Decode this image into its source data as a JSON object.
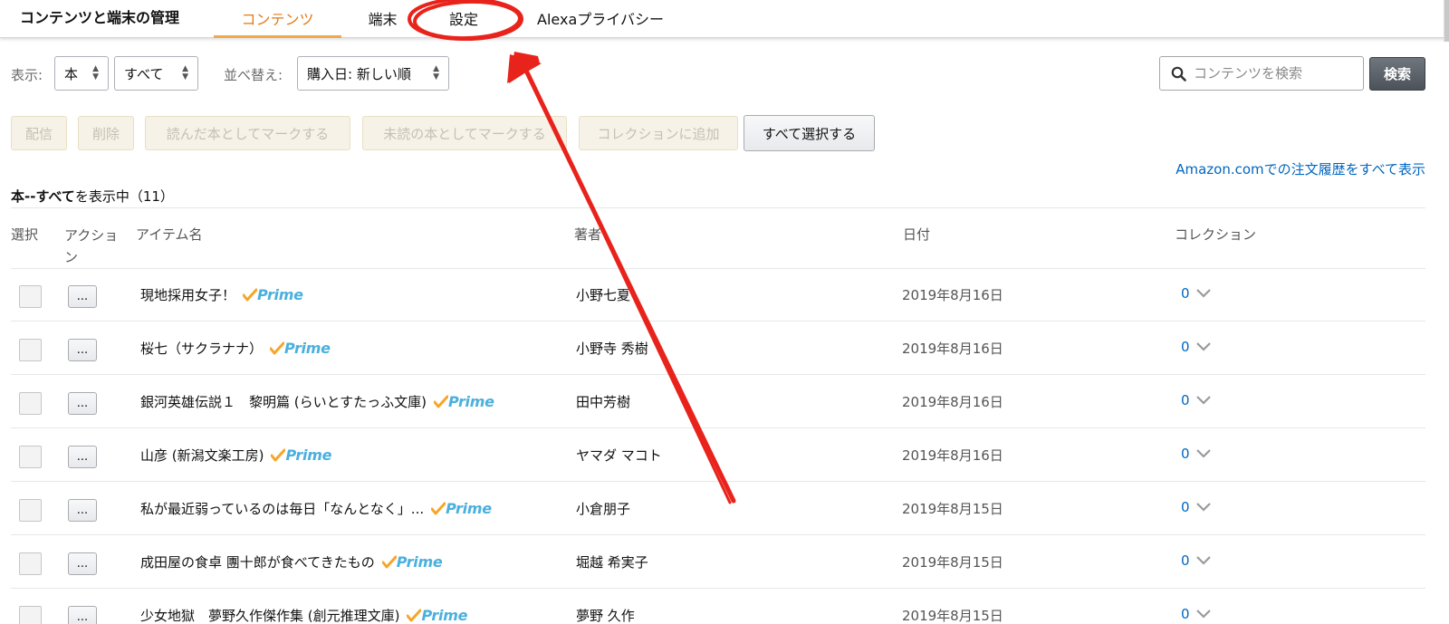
{
  "header": {
    "app_title": "コンテンツと端末の管理",
    "tabs": [
      {
        "label": "コンテンツ",
        "active": true
      },
      {
        "label": "端末",
        "active": false
      },
      {
        "label": "設定",
        "active": false
      },
      {
        "label": "Alexaプライバシー",
        "active": false
      }
    ]
  },
  "filters": {
    "display_label": "表示:",
    "display_type": "本",
    "display_scope": "すべて",
    "sort_label": "並べ替え:",
    "sort_value": "購入日: 新しい順",
    "search_placeholder": "コンテンツを検索",
    "search_button": "検索"
  },
  "actions": {
    "deliver": "配信",
    "delete": "削除",
    "mark_read": "読んだ本としてマークする",
    "mark_unread": "未読の本としてマークする",
    "add_collection": "コレクションに追加",
    "select_all": "すべて選択する"
  },
  "order_history_link": "Amazon.comでの注文履歴をすべて表示",
  "summary": {
    "bold": "本--すべて",
    "rest": "を表示中（11）"
  },
  "columns": {
    "select": "選択",
    "action": "アクション",
    "item_name": "アイテム名",
    "author": "著者",
    "date": "日付",
    "collection": "コレクション"
  },
  "prime_label": "Prime",
  "more_button": "...",
  "items": [
    {
      "title": "現地採用女子！",
      "prime": true,
      "author": "小野七夏",
      "date": "2019年8月16日",
      "collection": "0"
    },
    {
      "title": "桜七（サクラナナ）",
      "prime": true,
      "author": "小野寺 秀樹",
      "date": "2019年8月16日",
      "collection": "0"
    },
    {
      "title": "銀河英雄伝説１　黎明篇 (らいとすたっふ文庫)",
      "prime": true,
      "author": "田中芳樹",
      "date": "2019年8月16日",
      "collection": "0"
    },
    {
      "title": "山彦 (新潟文楽工房)",
      "prime": true,
      "author": "ヤマダ マコト",
      "date": "2019年8月16日",
      "collection": "0"
    },
    {
      "title": "私が最近弱っているのは毎日「なんとなく」...",
      "prime": true,
      "author": "小倉朋子",
      "date": "2019年8月15日",
      "collection": "0"
    },
    {
      "title": "成田屋の食卓 團十郎が食べてきたもの",
      "prime": true,
      "author": "堀越 希実子",
      "date": "2019年8月15日",
      "collection": "0"
    },
    {
      "title": "少女地獄　夢野久作傑作集 (創元推理文庫)",
      "prime": true,
      "author": "夢野 久作",
      "date": "2019年8月15日",
      "collection": "0"
    }
  ],
  "colors": {
    "active_tab": "#e47911",
    "link": "#0066c0",
    "prime": "#4ab0de",
    "prime_check": "#f7a528",
    "annotation": "#e8231b"
  }
}
